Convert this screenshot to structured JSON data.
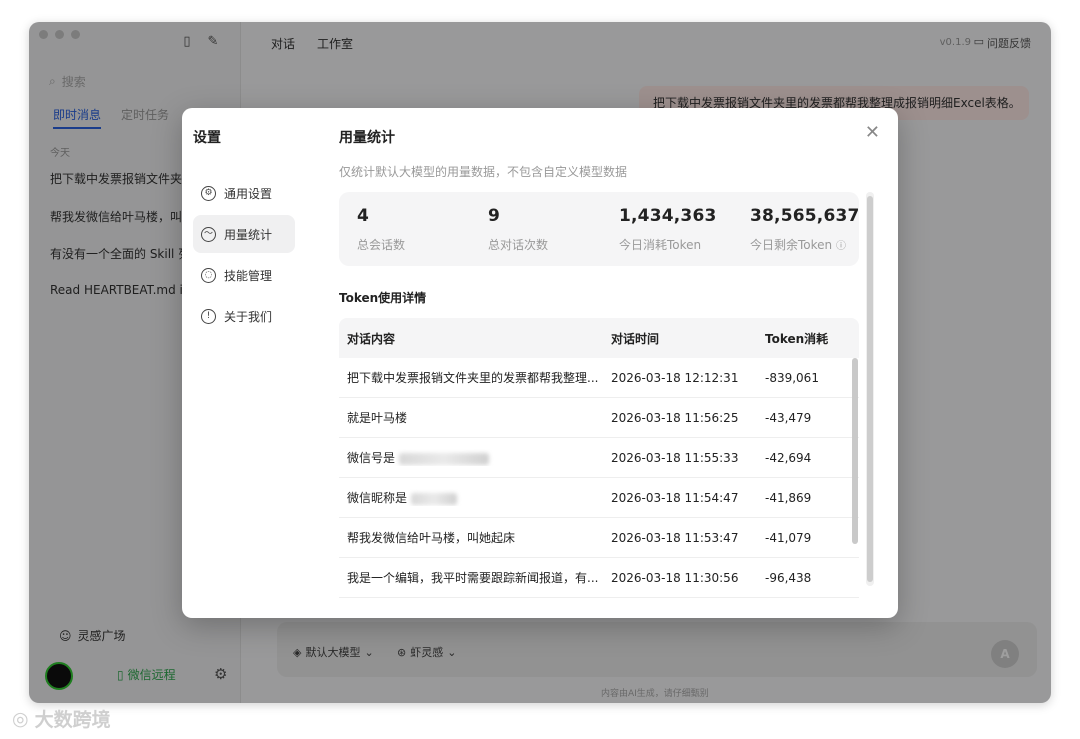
{
  "sidebar": {
    "search_placeholder": "搜索",
    "tabs": [
      "即时消息",
      "定时任务"
    ],
    "date_label": "今天",
    "conversations": [
      "把下载中发票报销文件夹里的发票都帮我整理成报销明细Excel表格。",
      "帮我发微信给叶马楼，叫她起床",
      "有没有一个全面的 Skill 列表",
      "Read HEARTBEAT.md if it exists"
    ],
    "inspiration": "灵感广场",
    "wechat_remote": "微信远程"
  },
  "topbar": {
    "tabs": [
      "对话",
      "工作室"
    ],
    "version": "v0.1.9",
    "feedback": "问题反馈"
  },
  "chat": {
    "user_message": "把下载中发票报销文件夹里的发票都帮我整理成报销明细Excel表格。",
    "model_chip": "默认大模型",
    "mode_chip": "虾灵感",
    "send_label": "A",
    "footer_note": "内容由AI生成，请仔细甄别"
  },
  "settings": {
    "title": "设置",
    "nav": [
      "通用设置",
      "用量统计",
      "技能管理",
      "关于我们"
    ],
    "active_nav": "用量统计",
    "section_title": "用量统计",
    "section_desc": "仅统计默认大模型的用量数据，不包含自定义模型数据",
    "stats": [
      {
        "value": "4",
        "label": "总会话数"
      },
      {
        "value": "9",
        "label": "总对话次数"
      },
      {
        "value": "1,434,363",
        "label": "今日消耗Token"
      },
      {
        "value": "38,565,637",
        "label": "今日剩余Token"
      }
    ],
    "detail_title": "Token使用详情",
    "table": {
      "headers": [
        "对话内容",
        "对话时间",
        "Token消耗"
      ],
      "rows": [
        {
          "content": "把下载中发票报销文件夹里的发票都帮我整理...",
          "time": "2026-03-18 12:12:31",
          "tokens": "-839,061"
        },
        {
          "content": "就是叶马楼",
          "time": "2026-03-18 11:56:25",
          "tokens": "-43,479"
        },
        {
          "content": "微信号是",
          "time": "2026-03-18 11:55:33",
          "tokens": "-42,694"
        },
        {
          "content": "微信昵称是",
          "time": "2026-03-18 11:54:47",
          "tokens": "-41,869"
        },
        {
          "content": "帮我发微信给叶马楼，叫她起床",
          "time": "2026-03-18 11:53:47",
          "tokens": "-41,079"
        },
        {
          "content": "我是一个编辑，我平时需要跟踪新闻报道，有...",
          "time": "2026-03-18 11:30:56",
          "tokens": "-96,438"
        }
      ]
    }
  },
  "watermark": "大数跨境"
}
